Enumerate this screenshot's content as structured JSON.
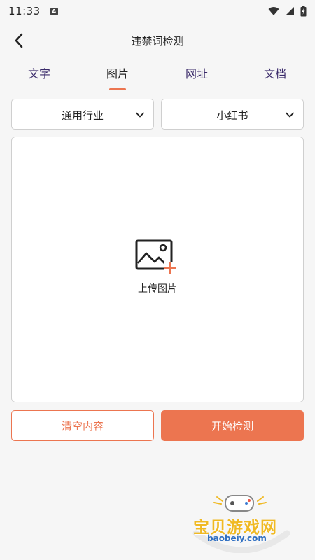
{
  "status_bar": {
    "time": "11:33",
    "notification_letter": "A"
  },
  "header": {
    "title": "违禁词检测"
  },
  "tabs": [
    {
      "label": "文字",
      "active": false
    },
    {
      "label": "图片",
      "active": true
    },
    {
      "label": "网址",
      "active": false
    },
    {
      "label": "文档",
      "active": false
    }
  ],
  "filters": {
    "industry": "通用行业",
    "platform": "小红书"
  },
  "upload": {
    "label": "上传图片",
    "icon": "image-add-icon"
  },
  "actions": {
    "clear_label": "清空内容",
    "start_label": "开始检测"
  },
  "watermark": {
    "text": "宝贝游戏网",
    "url": "baobeiy.com"
  },
  "colors": {
    "accent": "#ec7550",
    "tab_text": "#3a2a6a",
    "background": "#f6f6f6"
  }
}
